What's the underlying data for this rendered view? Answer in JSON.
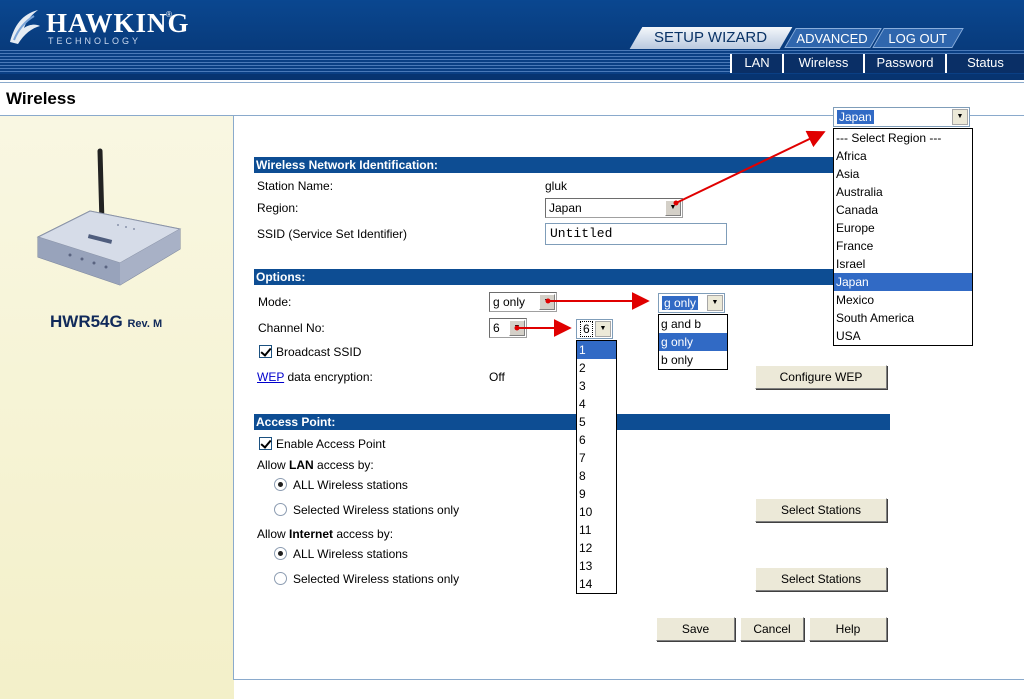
{
  "brand": {
    "name": "HAWKING",
    "tagline": "TECHNOLOGY",
    "registered": "®"
  },
  "top_tabs": [
    {
      "label": "SETUP WIZARD"
    },
    {
      "label": "ADVANCED"
    },
    {
      "label": "LOG OUT"
    }
  ],
  "subnav": [
    {
      "label": "LAN"
    },
    {
      "label": "Wireless"
    },
    {
      "label": "Password"
    },
    {
      "label": "Status"
    }
  ],
  "page_title": "Wireless",
  "sidebar": {
    "model": "HWR54G",
    "revision": "Rev. M"
  },
  "sections": {
    "identification": "Wireless Network Identification:",
    "options": "Options:",
    "access_point": "Access Point:"
  },
  "identification": {
    "station_name_label": "Station Name:",
    "station_name_value": "gluk",
    "region_label": "Region:",
    "region_value": "Japan",
    "ssid_label": "SSID (Service Set Identifier)",
    "ssid_value": "Untitled"
  },
  "options": {
    "mode_label": "Mode:",
    "mode_value": "g only",
    "channel_label": "Channel No:",
    "channel_value": "6",
    "broadcast_label": "Broadcast SSID",
    "broadcast_checked": true,
    "wep_link": "WEP",
    "wep_label_rest": " data encryption:",
    "wep_value": "Off",
    "configure_wep_button": "Configure WEP"
  },
  "access_point": {
    "enable_label": "Enable Access Point",
    "enable_checked": true,
    "allow_lan_prefix": "Allow ",
    "allow_lan_bold": "LAN",
    "allow_lan_suffix": " access by:",
    "allow_internet_prefix": "Allow ",
    "allow_internet_bold": "Internet",
    "allow_internet_suffix": " access by:",
    "all_stations": "ALL Wireless stations",
    "selected_stations": "Selected Wireless stations only",
    "select_stations_button": "Select Stations"
  },
  "footer_buttons": {
    "save": "Save",
    "cancel": "Cancel",
    "help": "Help"
  },
  "popups": {
    "region": {
      "value": "Japan",
      "options": [
        "--- Select Region ---",
        "Africa",
        "Asia",
        "Australia",
        "Canada",
        "Europe",
        "France",
        "Israel",
        "Japan",
        "Mexico",
        "South America",
        "USA"
      ],
      "selected": "Japan"
    },
    "mode": {
      "value": "g only",
      "options": [
        "g and b",
        "g only",
        "b only"
      ],
      "selected": "g only"
    },
    "channel": {
      "value": "6",
      "options": [
        "1",
        "2",
        "3",
        "4",
        "5",
        "6",
        "7",
        "8",
        "9",
        "10",
        "11",
        "12",
        "13",
        "14"
      ],
      "selected": "1"
    }
  },
  "colors": {
    "header_blue": "#0a3f84",
    "section_bar": "#0d4d93",
    "highlight": "#316ac5",
    "arrow": "#e00000",
    "sidebar_bg": "#f6f3d4"
  }
}
